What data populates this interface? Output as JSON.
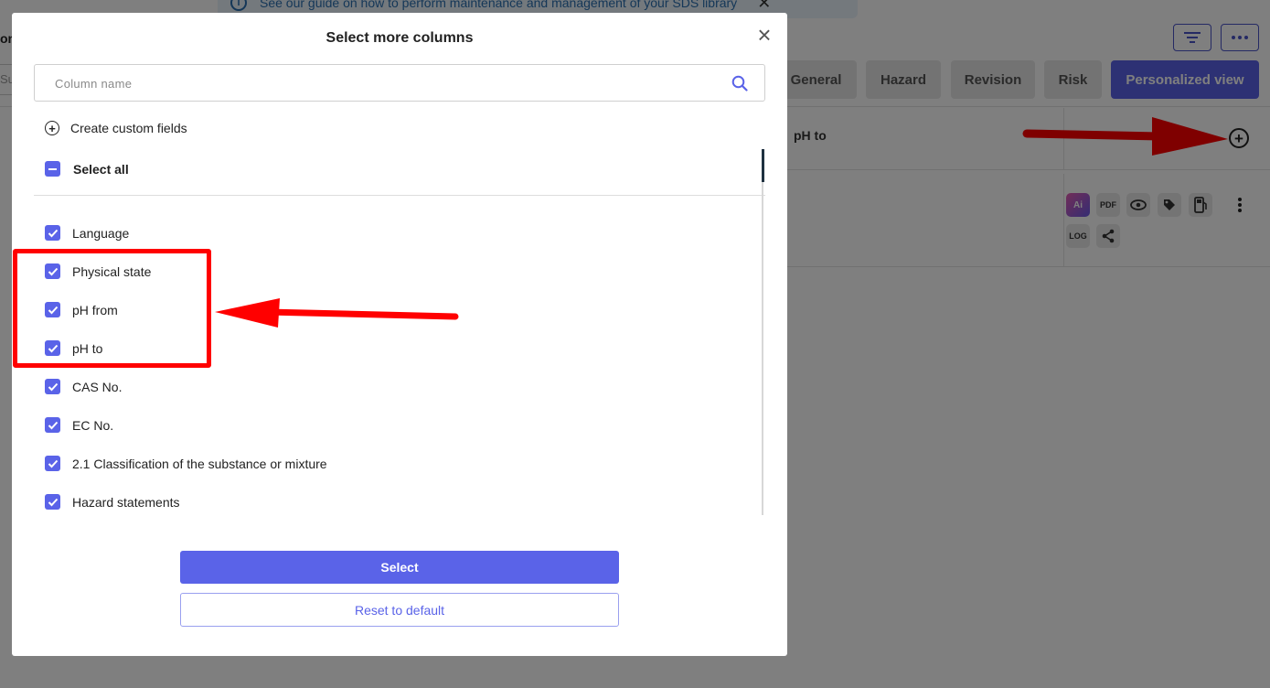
{
  "page": {
    "banner_text": "See our guide on how to perform maintenance and management of your SDS library",
    "banner_close": "✕",
    "page_label": "on",
    "search_stub": "Su",
    "view_tabs": [
      {
        "label": "General"
      },
      {
        "label": "Hazard"
      },
      {
        "label": "Revision"
      },
      {
        "label": "Risk"
      },
      {
        "label": "Personalized view",
        "active": true
      }
    ],
    "grid_column_header": "pH to",
    "row_icons": [
      "ai-icon",
      "pdf-icon",
      "eye-icon",
      "tag-icon",
      "fuel-icon",
      "kebab-icon",
      "log-icon",
      "share-icon"
    ],
    "row_icon_labels": {
      "ai": "Ai",
      "pdf": "PDF",
      "log": "LOG"
    }
  },
  "modal": {
    "title": "Select more columns",
    "close": "×",
    "search": {
      "placeholder": "Column name",
      "value": ""
    },
    "create_custom_fields": "Create custom fields",
    "select_all": "Select all",
    "columns": [
      {
        "label": "Language",
        "checked": true
      },
      {
        "label": "Physical state",
        "checked": true
      },
      {
        "label": "pH from",
        "checked": true
      },
      {
        "label": "pH to",
        "checked": true
      },
      {
        "label": "CAS No.",
        "checked": true
      },
      {
        "label": "EC No.",
        "checked": true
      },
      {
        "label": "2.1 Classification of the substance or mixture",
        "checked": true
      },
      {
        "label": "Hazard statements",
        "checked": true
      }
    ],
    "select_button": "Select",
    "reset_button": "Reset to default"
  },
  "colors": {
    "accent": "#5a63e8",
    "annotation": "#ff0000",
    "overlay": "rgba(0,0,0,0.5)"
  }
}
